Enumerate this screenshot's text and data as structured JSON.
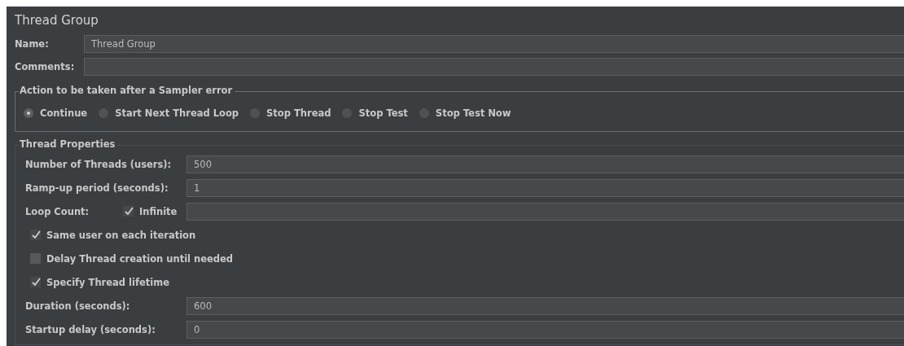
{
  "title": "Thread Group",
  "name": {
    "label": "Name:",
    "value": "Thread Group"
  },
  "comments": {
    "label": "Comments:"
  },
  "sampler_error": {
    "legend": "Action to be taken after a Sampler error",
    "options": [
      {
        "label": "Continue",
        "selected": true
      },
      {
        "label": "Start Next Thread Loop",
        "selected": false
      },
      {
        "label": "Stop Thread",
        "selected": false
      },
      {
        "label": "Stop Test",
        "selected": false
      },
      {
        "label": "Stop Test Now",
        "selected": false
      }
    ]
  },
  "thread_properties": {
    "legend": "Thread Properties",
    "number_of_threads": {
      "label": "Number of Threads (users):",
      "value": "500"
    },
    "ramp_up": {
      "label": "Ramp-up period (seconds):",
      "value": "1"
    },
    "loop_count": {
      "label": "Loop Count:",
      "infinite": {
        "label": "Infinite",
        "checked": true
      }
    },
    "options": [
      {
        "label": "Same user on each iteration",
        "checked": true
      },
      {
        "label": "Delay Thread creation until needed",
        "checked": false
      },
      {
        "label": "Specify Thread lifetime",
        "checked": true
      }
    ],
    "duration": {
      "label": "Duration (seconds):",
      "value": "600"
    },
    "startup_delay": {
      "label": "Startup delay (seconds):",
      "value": "0"
    }
  }
}
